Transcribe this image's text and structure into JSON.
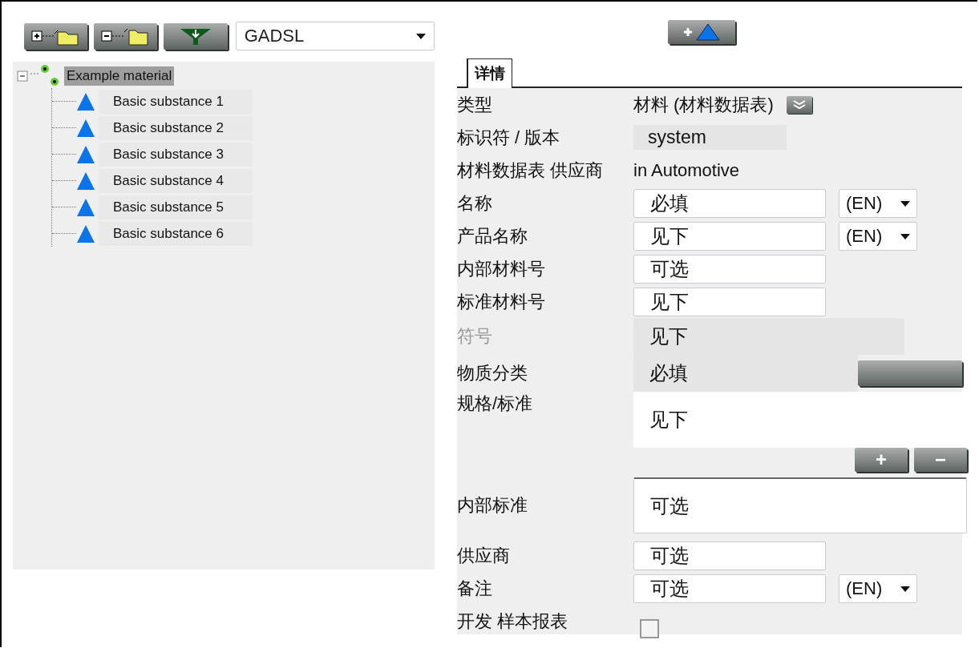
{
  "toolbar": {
    "filter_value": "GADSL"
  },
  "tree": {
    "root": {
      "label": "Example material",
      "selected": true,
      "expanded": true,
      "children": [
        {
          "label": "Basic substance 1",
          "selected": false
        },
        {
          "label": "Basic substance 2",
          "selected": false
        },
        {
          "label": "Basic substance 3",
          "selected": false
        },
        {
          "label": "Basic substance 4",
          "selected": false
        },
        {
          "label": "Basic substance 5",
          "selected": false
        },
        {
          "label": "Basic substance 6",
          "selected": false
        }
      ]
    }
  },
  "tabs": [
    {
      "label": "详情",
      "selected": true
    }
  ],
  "form": [
    {
      "label": "类型",
      "kind": "text",
      "value": "材料 (材料数据表)",
      "disabled": false
    },
    {
      "label": "标识符 / 版本",
      "kind": "overlay",
      "note": "system",
      "disabled": false
    },
    {
      "label": "材料数据表 供应商",
      "kind": "text",
      "value": "in Automotive",
      "disabled": false
    },
    {
      "label": "名称",
      "kind": "field-lang",
      "note": "必填",
      "lang": "(EN)",
      "disabled": false
    },
    {
      "label": "产品名称",
      "kind": "field-lang",
      "note": "见下",
      "lang": "(EN)",
      "disabled": false
    },
    {
      "label": "内部材料号",
      "kind": "field",
      "note": "可选",
      "disabled": false
    },
    {
      "label": "标准材料号",
      "kind": "field",
      "note": "见下",
      "disabled": false
    },
    {
      "label": "符号",
      "kind": "shaded",
      "note": "见下",
      "disabled": true
    },
    {
      "label": "物质分类",
      "kind": "shaded-find",
      "note": "必填",
      "disabled": false
    },
    {
      "label": "规格/标准",
      "kind": "area-buttons",
      "note": "见下",
      "add": "+",
      "remove": "−",
      "disabled": false
    },
    {
      "label": "内部标准",
      "kind": "area",
      "note": "可选",
      "disabled": false
    },
    {
      "label": "供应商",
      "kind": "field",
      "note": "可选",
      "disabled": false
    },
    {
      "label": "备注",
      "kind": "field-lang",
      "note": "可选",
      "lang": "(EN)",
      "disabled": false
    },
    {
      "label": "开发 样本报表",
      "kind": "checkbox",
      "checked": false,
      "disabled": false
    }
  ]
}
